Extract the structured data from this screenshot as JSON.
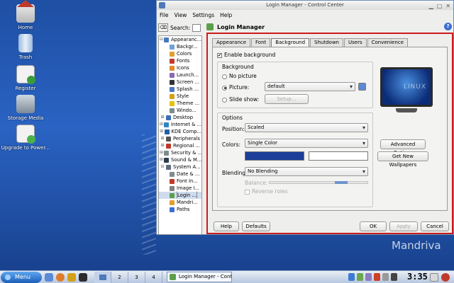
{
  "desktop": {
    "icons": [
      {
        "label": "Home",
        "icon": "home-icon"
      },
      {
        "label": "Trash",
        "icon": "trash-icon"
      },
      {
        "label": "Register",
        "icon": "register-icon"
      },
      {
        "label": "Storage Media",
        "icon": "storage-media-icon"
      },
      {
        "label": "Upgrade to Power...",
        "icon": "upgrade-icon"
      }
    ],
    "brand": "Mandriva"
  },
  "window": {
    "title": "Login Manager - Control Center",
    "menu": [
      "File",
      "View",
      "Settings",
      "Help"
    ],
    "search_label": "Search:",
    "page_title": "Login Manager",
    "tree": [
      {
        "label": "Appearanc...",
        "exp": "⊟",
        "level": 0,
        "color": "#4a78c0"
      },
      {
        "label": "Backgr...",
        "level": 1,
        "color": "#6fa0d8"
      },
      {
        "label": "Colors",
        "level": 1,
        "color": "#e0a030"
      },
      {
        "label": "Fonts",
        "level": 1,
        "color": "#c0392b"
      },
      {
        "label": "Icons",
        "level": 1,
        "color": "#e08a2b"
      },
      {
        "label": "Launch...",
        "level": 1,
        "color": "#8c6bb1"
      },
      {
        "label": "Screen ...",
        "level": 1,
        "color": "#333333"
      },
      {
        "label": "Splash ...",
        "level": 1,
        "color": "#4a78c0"
      },
      {
        "label": "Style",
        "level": 1,
        "color": "#d4a017"
      },
      {
        "label": "Theme ...",
        "level": 1,
        "color": "#e6c200"
      },
      {
        "label": "Windo...",
        "level": 1,
        "color": "#7f8c8d"
      },
      {
        "label": "Desktop",
        "exp": "⊞",
        "level": 0,
        "color": "#3b6fb6"
      },
      {
        "label": "Internet & ...",
        "exp": "⊞",
        "level": 0,
        "color": "#2e86c1"
      },
      {
        "label": "KDE Comp...",
        "exp": "⊞",
        "level": 0,
        "color": "#1f5fa8"
      },
      {
        "label": "Peripherals",
        "exp": "⊞",
        "level": 0,
        "color": "#555555"
      },
      {
        "label": "Regional ...",
        "exp": "⊞",
        "level": 0,
        "color": "#c0392b"
      },
      {
        "label": "Security & ...",
        "exp": "⊞",
        "level": 0,
        "color": "#7f8c8d"
      },
      {
        "label": "Sound & M...",
        "exp": "⊞",
        "level": 0,
        "color": "#2c3e50"
      },
      {
        "label": "System A...",
        "exp": "⊟",
        "level": 0,
        "color": "#5d6d7e"
      },
      {
        "label": "Date & ...",
        "level": 1,
        "color": "#7f8c8d"
      },
      {
        "label": "Font In...",
        "level": 1,
        "color": "#c0392b"
      },
      {
        "label": "Image I...",
        "level": 1,
        "color": "#808080"
      },
      {
        "label": "Login ...",
        "level": 1,
        "color": "#5b9f4a",
        "selected": true
      },
      {
        "label": "Mandri...",
        "level": 1,
        "color": "#e0a030"
      },
      {
        "label": "Paths",
        "level": 1,
        "color": "#3d6fd0"
      }
    ],
    "tabs": [
      "Appearance",
      "Font",
      "Background",
      "Shutdown",
      "Users",
      "Convenience"
    ],
    "active_tab": 2,
    "bg": {
      "enable_label": "Enable background",
      "enable_checked": true,
      "background_group": "Background",
      "no_picture": "No picture",
      "picture": "Picture:",
      "picture_value": "default",
      "slide_show": "Slide show:",
      "setup": "Setup...",
      "options_group": "Options",
      "position_label": "Position:",
      "position_value": "Scaled",
      "colors_label": "Colors:",
      "colors_value": "Single Color",
      "color_primary": "#1d3f9a",
      "color_secondary": "#ffffff",
      "blending_label": "Blending:",
      "blending_value": "No Blending",
      "balance_label": "Balance:",
      "reverse_roles": "Reverse roles",
      "advanced": "Advanced Options",
      "get_new": "Get New Wallpapers",
      "monitor_text": "LINUX"
    },
    "buttons": {
      "help": "Help",
      "defaults": "Defaults",
      "ok": "OK",
      "apply": "Apply",
      "cancel": "Cancel"
    }
  },
  "taskbar": {
    "menu": "Menu",
    "pages": [
      "1",
      "2",
      "3",
      "4"
    ],
    "task": "Login Manager - Contr...",
    "clock": "3:35"
  }
}
